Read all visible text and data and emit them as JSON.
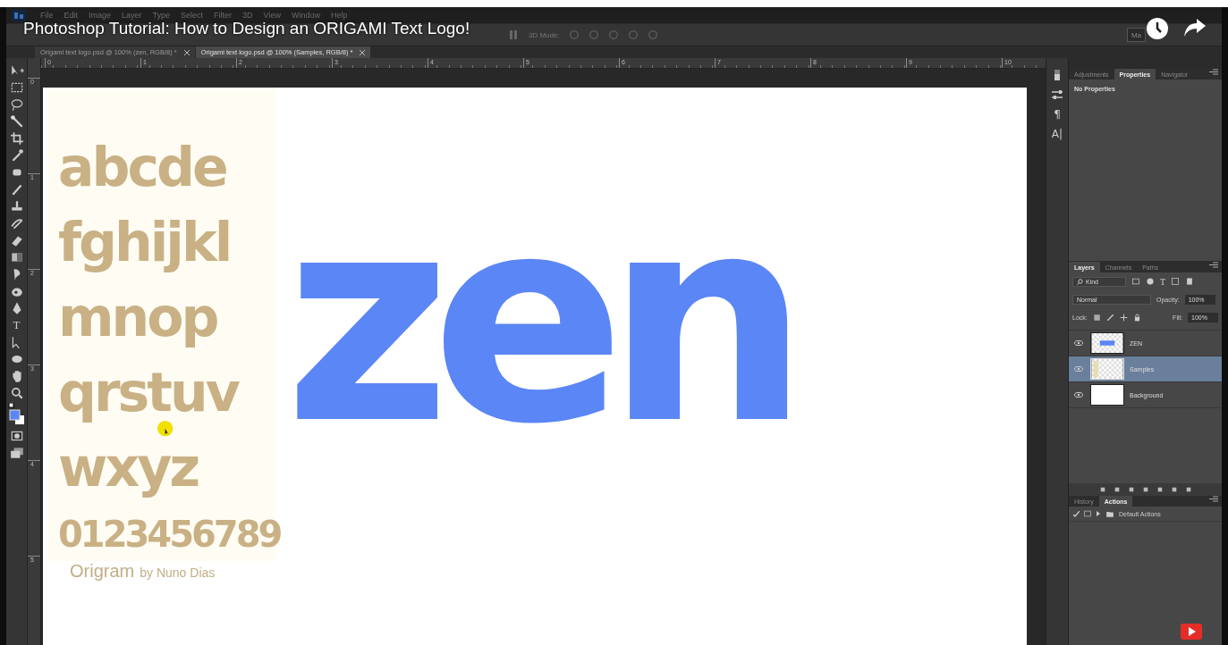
{
  "video_title": "Photoshop Tutorial: How to Design an ORIGAMI Text Logo!",
  "menu": [
    "File",
    "Edit",
    "Image",
    "Layer",
    "Type",
    "Select",
    "Filter",
    "3D",
    "View",
    "Window",
    "Help"
  ],
  "options_bar": {
    "mode_label": "3D Mode:",
    "workspace": "Ma"
  },
  "doc_tabs": [
    {
      "label": "Origami text logo.psd @ 100% (zen, RGB/8) *",
      "selected": false
    },
    {
      "label": "Origami text logo.psd @ 100% (Samples, RGB/8) *",
      "selected": true
    }
  ],
  "ruler_h": [
    "0",
    "1",
    "2",
    "3",
    "4",
    "5",
    "6",
    "7",
    "8",
    "9",
    "10"
  ],
  "ruler_v": [
    "0",
    "1",
    "2",
    "3",
    "4",
    "5"
  ],
  "type_tool_glyph": "T",
  "dock_glyphs": [
    "¶",
    "A|"
  ],
  "document": {
    "specimen_rows": [
      "abcde",
      "fghijkl",
      "mnop",
      "qrstuv",
      "wxyz",
      "0123456789"
    ],
    "font_name": "Origram",
    "font_author": "by Nuno Dias",
    "logo": "zen"
  },
  "properties_panel": {
    "tabs": [
      {
        "label": "Adjustments",
        "selected": false
      },
      {
        "label": "Properties",
        "selected": true
      },
      {
        "label": "Navigator",
        "selected": false
      }
    ],
    "message": "No Properties"
  },
  "layers_panel": {
    "tabs": [
      {
        "label": "Layers",
        "selected": true
      },
      {
        "label": "Channels",
        "selected": false
      },
      {
        "label": "Paths",
        "selected": false
      }
    ],
    "filter": "Kind",
    "filter_glyph": "T",
    "blend_mode": "Normal",
    "opacity_label": "Opacity:",
    "opacity": "100%",
    "lock_label": "Lock:",
    "fill_label": "Fill:",
    "fill": "100%",
    "layers": [
      {
        "name": "ZEN",
        "kind": "text",
        "visible": true,
        "selected": false
      },
      {
        "name": "Samples",
        "kind": "transparent",
        "visible": true,
        "selected": true
      },
      {
        "name": "Background",
        "kind": "white",
        "visible": true,
        "selected": false
      }
    ]
  },
  "actions_panel": {
    "tabs": [
      {
        "label": "History",
        "selected": false
      },
      {
        "label": "Actions",
        "selected": true
      }
    ],
    "items": [
      {
        "name": "Default Actions",
        "checked": true,
        "expanded": false
      }
    ]
  }
}
